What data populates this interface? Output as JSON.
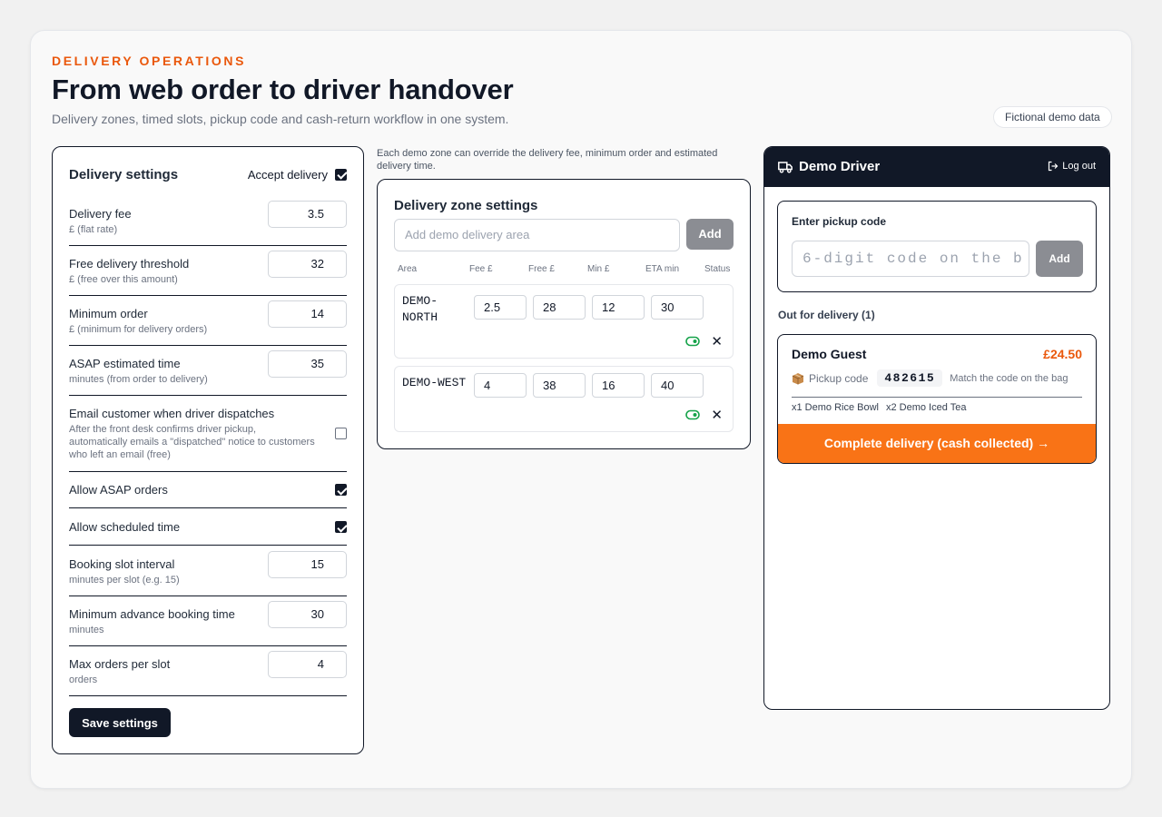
{
  "header": {
    "eyebrow": "DELIVERY OPERATIONS",
    "title": "From web order to driver handover",
    "subtitle": "Delivery zones, timed slots, pickup code and cash-return workflow in one system.",
    "demo_pill": "Fictional demo data"
  },
  "settings": {
    "title": "Delivery settings",
    "accept_label": "Accept delivery",
    "accept_checked": true,
    "fields": [
      {
        "label": "Delivery fee",
        "hint": "£ (flat rate)",
        "value": "3.5"
      },
      {
        "label": "Free delivery threshold",
        "hint": "£ (free over this amount)",
        "value": "32"
      },
      {
        "label": "Minimum order",
        "hint": "£ (minimum for delivery orders)",
        "value": "14"
      },
      {
        "label": "ASAP estimated time",
        "hint": "minutes (from order to delivery)",
        "value": "35"
      }
    ],
    "email_label": "Email customer when driver dispatches",
    "email_hint": "After the front desk confirms driver pickup, automatically emails a \"dispatched\" notice to customers who left an email (free)",
    "email_checked": false,
    "asap_label": "Allow ASAP orders",
    "asap_checked": true,
    "scheduled_label": "Allow scheduled time",
    "scheduled_checked": true,
    "slot_fields": [
      {
        "label": "Booking slot interval",
        "hint": "minutes per slot (e.g. 15)",
        "value": "15"
      },
      {
        "label": "Minimum advance booking time",
        "hint": "minutes",
        "value": "30"
      },
      {
        "label": "Max orders per slot",
        "hint": "orders",
        "value": "4"
      }
    ],
    "save_label": "Save settings"
  },
  "zones": {
    "note": "Each demo zone can override the delivery fee, minimum order and estimated delivery time.",
    "title": "Delivery zone settings",
    "input_placeholder": "Add demo delivery area",
    "add_label": "Add",
    "columns": [
      "Area",
      "Fee £",
      "Free £",
      "Min £",
      "ETA min",
      "Status"
    ],
    "rows": [
      {
        "name": "DEMO-\nNORTH",
        "fee": "2.5",
        "free": "28",
        "min": "12",
        "eta": "30",
        "close": "✕"
      },
      {
        "name": "DEMO-WEST",
        "fee": "4",
        "free": "38",
        "min": "16",
        "eta": "40",
        "close": "✕"
      }
    ],
    "toggle_color": "#16a34a"
  },
  "driver": {
    "title": "Demo Driver",
    "logout_label": "Log out",
    "pickup_title": "Enter pickup code",
    "pickup_placeholder": "6-digit code on the b",
    "pickup_add": "Add",
    "out_label": "Out for delivery (1)",
    "order": {
      "guest": "Demo Guest",
      "total": "£24.50",
      "pickup_label": "Pickup code",
      "code": "482615",
      "match": "Match the code on the bag",
      "items": [
        "x1 Demo Rice Bowl",
        "x2 Demo Iced Tea"
      ],
      "complete_label": "Complete delivery (cash collected) →"
    }
  },
  "colors": {
    "accent": "#ea580c",
    "dark": "#111827",
    "button_orange": "#f97316"
  }
}
